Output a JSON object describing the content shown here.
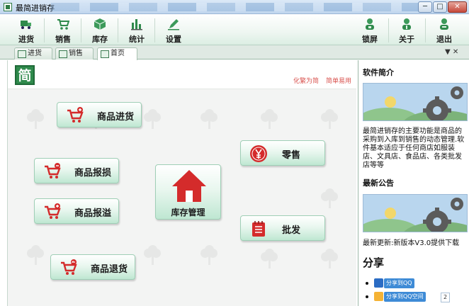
{
  "window": {
    "title": "最简进销存",
    "minimize_glyph": "─",
    "maximize_glyph": "□",
    "close_glyph": "✕"
  },
  "toolbar": {
    "left": [
      {
        "label": "进货",
        "icon": "truck-icon"
      },
      {
        "label": "销售",
        "icon": "cart-icon"
      },
      {
        "label": "库存",
        "icon": "box-icon"
      },
      {
        "label": "统计",
        "icon": "bar-chart-icon"
      },
      {
        "label": "设置",
        "icon": "pencil-icon"
      }
    ],
    "right": [
      {
        "label": "锁屏",
        "icon": "user-lock-icon"
      },
      {
        "label": "关于",
        "icon": "user-info-icon"
      },
      {
        "label": "退出",
        "icon": "user-exit-icon"
      }
    ]
  },
  "tabs": [
    {
      "label": "进货",
      "active": false
    },
    {
      "label": "销售",
      "active": false
    },
    {
      "label": "首页",
      "active": true
    }
  ],
  "tab_controls": "▼ ✕",
  "main": {
    "logo_char": "简",
    "links": {
      "traditional": "化繁为简",
      "simple": "简单易用"
    },
    "buttons": {
      "purchase": "商品进货",
      "damage": "商品报损",
      "overflow": "商品报溢",
      "returns": "商品退货",
      "inventory": "库存管理",
      "retail": "零售",
      "wholesale": "批发"
    }
  },
  "sidebar": {
    "intro_title": "软件简介",
    "intro_text": "最简进销存的主要功能是商品的采购到入库到销售的动态管理.软件基本适应于任何商店如服装店、文具店、食品店、各类批发店等等",
    "news_title": "最新公告",
    "news_text": "最新更新:新版本V3.0提供下载",
    "share_title": "分享",
    "share_items": [
      "分享到QQ",
      "分享到QQ空间"
    ],
    "share_count": "2"
  },
  "colors": {
    "accent_green": "#2f8a4c",
    "button_red": "#d42b2b",
    "link_red": "#d9534f"
  }
}
